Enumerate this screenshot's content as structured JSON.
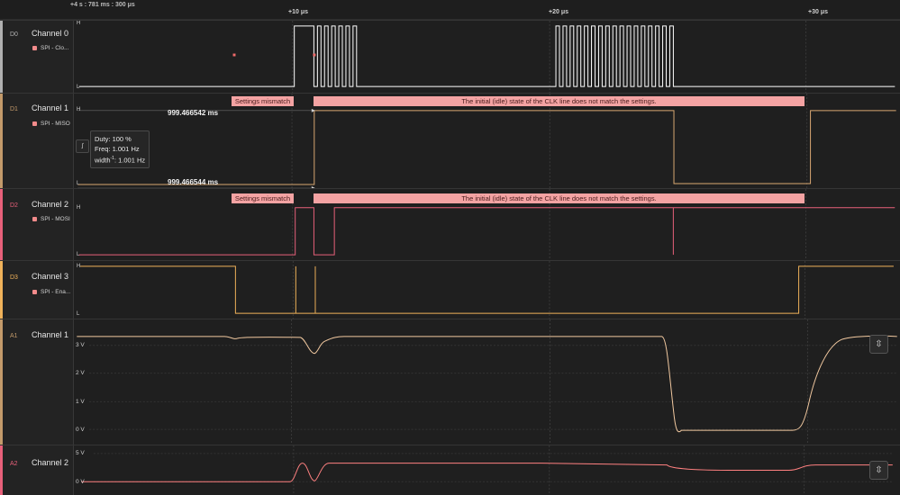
{
  "ruler": {
    "start_label": "+4 s : 781 ms : 300 μs",
    "ticks": [
      "+10 μs",
      "+20 μs",
      "+30 μs"
    ]
  },
  "level_labels": {
    "high": "H",
    "low": "L"
  },
  "channels": [
    {
      "id": "D0",
      "name": "Channel 0",
      "analyzer": "SPI - Clo...",
      "color": "#b0b0b0"
    },
    {
      "id": "D1",
      "name": "Channel 1",
      "analyzer": "SPI - MISO",
      "color": "#c39a6a"
    },
    {
      "id": "D2",
      "name": "Channel 2",
      "analyzer": "SPI - MOSI",
      "color": "#e8607a"
    },
    {
      "id": "D3",
      "name": "Channel 3",
      "analyzer": "SPI - Ena...",
      "color": "#f0b25a"
    },
    {
      "id": "A1",
      "name": "Channel 1",
      "color": "#c39a6a",
      "y_labels": [
        "3 V",
        "2 V",
        "1 V",
        "0 V"
      ]
    },
    {
      "id": "A2",
      "name": "Channel 2",
      "color": "#e8607a",
      "y_labels": [
        "5 V",
        "0 V"
      ]
    }
  ],
  "annotations": {
    "mismatch_short": "Settings mismatch",
    "mismatch_long": "The initial (idle) state of the CLK line does not match the settings."
  },
  "measurement": {
    "top_time": "999.466542 ms",
    "bottom_time": "999.466544 ms",
    "duty": "Duty: 100 %",
    "freq": "Freq: 1.001 Hz",
    "width_prefix": "width",
    "width_exp": "-1",
    "width_value": ": 1.001 Hz"
  },
  "colors": {
    "grid": "#3a3a3a",
    "clock_wave": "#ffffff",
    "miso_wave": "#d9a872",
    "mosi_wave": "#e8607a",
    "enable_wave": "#f0b25a",
    "analog1_wave": "#f2c9a0",
    "analog2_wave": "#ff8080",
    "mismatch_bg": "#f4a3a3"
  }
}
